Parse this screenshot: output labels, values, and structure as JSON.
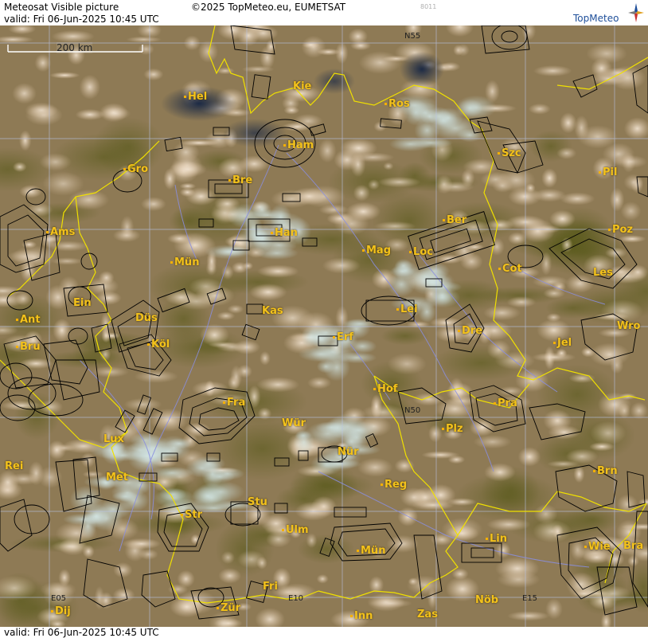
{
  "header": {
    "product": "Meteosat Visible picture",
    "copyright": "©2025 TopMeteo.eu, EUMETSAT",
    "valid": "valid:  Fri  06-Jun-2025  10:45 UTC",
    "code": "8011"
  },
  "footer": {
    "valid": "valid:  Fri  06-Jun-2025  10:45 UTC"
  },
  "logo": {
    "text": "TopMeteo",
    "icon": "compass-star-icon"
  },
  "scale": {
    "label": "200 km"
  },
  "colors": {
    "border": "#f0e000",
    "river": "#8a8ee0",
    "grid": "#b8c4e8",
    "label": "#f3c21b",
    "airspace": "#000000"
  },
  "grid_labels": [
    {
      "id": "n55",
      "text": "N55"
    },
    {
      "id": "n50",
      "text": "N50"
    },
    {
      "id": "e05",
      "text": "E05"
    },
    {
      "id": "e10",
      "text": "E10"
    },
    {
      "id": "e15",
      "text": "E15"
    }
  ],
  "cities": [
    {
      "id": "hel",
      "text": "Hel"
    },
    {
      "id": "kie",
      "text": "Kie"
    },
    {
      "id": "ros",
      "text": "Ros"
    },
    {
      "id": "ham",
      "text": "Ham"
    },
    {
      "id": "szc",
      "text": "Szc"
    },
    {
      "id": "gro",
      "text": "Gro"
    },
    {
      "id": "bre",
      "text": "Bre"
    },
    {
      "id": "pil",
      "text": "Pil"
    },
    {
      "id": "ber",
      "text": "Ber"
    },
    {
      "id": "han",
      "text": "Han"
    },
    {
      "id": "ams",
      "text": "Ams"
    },
    {
      "id": "poz",
      "text": "Poz"
    },
    {
      "id": "mag",
      "text": "Mag"
    },
    {
      "id": "loc",
      "text": "Loc"
    },
    {
      "id": "mun",
      "text": "Mün"
    },
    {
      "id": "cot",
      "text": "Cot"
    },
    {
      "id": "les",
      "text": "Les"
    },
    {
      "id": "ein",
      "text": "Ein"
    },
    {
      "id": "kas",
      "text": "Kas"
    },
    {
      "id": "lei",
      "text": "Lei"
    },
    {
      "id": "ant",
      "text": "Ant"
    },
    {
      "id": "dus",
      "text": "Düs"
    },
    {
      "id": "dre",
      "text": "Dre"
    },
    {
      "id": "wro",
      "text": "Wro"
    },
    {
      "id": "bru",
      "text": "Bru"
    },
    {
      "id": "kol",
      "text": "Köl"
    },
    {
      "id": "erf",
      "text": "Erf"
    },
    {
      "id": "jel",
      "text": "Jel"
    },
    {
      "id": "hof",
      "text": "Hof"
    },
    {
      "id": "fra",
      "text": "Fra"
    },
    {
      "id": "pra",
      "text": "Pra"
    },
    {
      "id": "wur",
      "text": "Wür"
    },
    {
      "id": "plz",
      "text": "Plz"
    },
    {
      "id": "lux",
      "text": "Lux"
    },
    {
      "id": "nur",
      "text": "Nür"
    },
    {
      "id": "rei",
      "text": "Rei"
    },
    {
      "id": "met",
      "text": "Met"
    },
    {
      "id": "reg",
      "text": "Reg"
    },
    {
      "id": "brn",
      "text": "Brn"
    },
    {
      "id": "stu",
      "text": "Stu"
    },
    {
      "id": "str",
      "text": "Str"
    },
    {
      "id": "ulm",
      "text": "Ulm"
    },
    {
      "id": "lin",
      "text": "Lin"
    },
    {
      "id": "mue",
      "text": "Mün"
    },
    {
      "id": "wie",
      "text": "Wie"
    },
    {
      "id": "bra",
      "text": "Bra"
    },
    {
      "id": "fri",
      "text": "Fri"
    },
    {
      "id": "nob",
      "text": "Nöb"
    },
    {
      "id": "dij",
      "text": "Dij"
    },
    {
      "id": "zur",
      "text": "Zür"
    },
    {
      "id": "inn",
      "text": "Inn"
    },
    {
      "id": "zas",
      "text": "Zas"
    }
  ]
}
